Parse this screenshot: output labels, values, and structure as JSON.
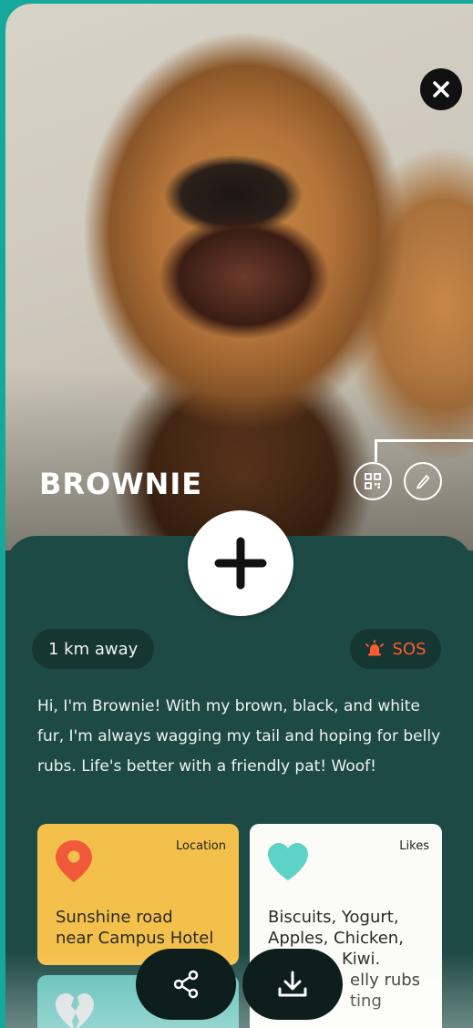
{
  "pet": {
    "name": "BROWNIE"
  },
  "header": {
    "close_icon": "close-icon",
    "qr_icon": "qr-code-icon",
    "edit_icon": "pencil-icon"
  },
  "add_button": {
    "icon": "plus-icon"
  },
  "distance": "1 km away",
  "sos": {
    "label": "SOS",
    "icon": "alarm-bell-icon",
    "color": "#ff5a32"
  },
  "bio": "Hi, I'm Brownie! With my brown, black, and white fur, I'm always wagging my tail and hoping for belly rubs. Life's better with a friendly pat! Woof!",
  "cards": {
    "location": {
      "title": "Location",
      "text_line1": "Sunshine road",
      "text_line2": "near Campus Hotel",
      "icon": "map-pin-icon",
      "color": "#f4c04c"
    },
    "likes": {
      "title": "Likes",
      "line1": "Biscuits, Yogurt,",
      "line2": "Apples, Chicken,",
      "line3": "Kiwi.",
      "line4": "elly rubs",
      "line5": "ting",
      "icon": "heart-icon",
      "color": "#fbfbf7"
    },
    "dislikes": {
      "icon": "broken-heart-icon",
      "color": "#5dbfb7"
    }
  },
  "actions": {
    "share_icon": "share-icon",
    "download_icon": "download-icon"
  },
  "colors": {
    "accent": "#14a99a",
    "panel": "#1e4a45"
  }
}
